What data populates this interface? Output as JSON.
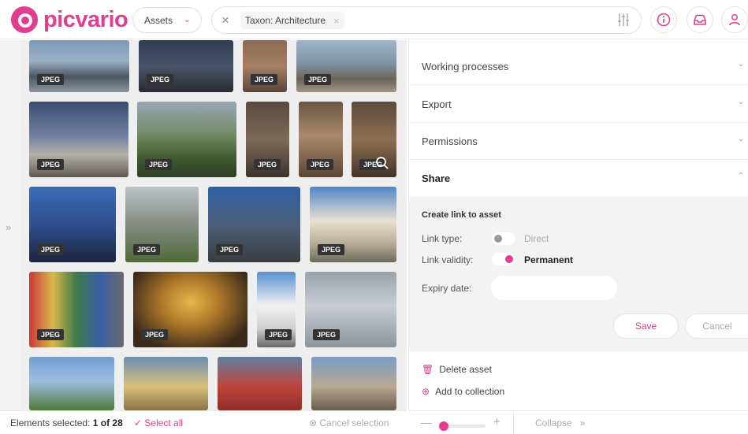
{
  "header": {
    "logo_text": "picvario",
    "assets_dropdown": "Assets",
    "filter_chip": "Taxon: Architecture"
  },
  "gallery": {
    "rows": [
      [
        {
          "format": "JPEG"
        },
        {
          "format": "JPEG"
        },
        {
          "format": "JPEG"
        },
        {
          "format": "JPEG"
        }
      ],
      [
        {
          "format": "JPEG"
        },
        {
          "format": "JPEG"
        },
        {
          "format": "JPEG"
        },
        {
          "format": "JPEG"
        },
        {
          "format": "JPEG"
        }
      ],
      [
        {
          "format": "JPEG"
        },
        {
          "format": "JPEG"
        },
        {
          "format": "JPEG"
        },
        {
          "format": "JPEG"
        }
      ],
      [
        {
          "format": "JPEG"
        },
        {
          "format": "JPEG"
        },
        {
          "format": "JPEG"
        },
        {
          "format": "JPEG"
        }
      ],
      [
        {
          "format": ""
        },
        {
          "format": ""
        },
        {
          "format": ""
        },
        {
          "format": ""
        }
      ]
    ]
  },
  "footer_left": {
    "selected_label": "Elements selected:",
    "selected_count": "1 of 28",
    "select_all": "Select all",
    "cancel_selection": "Cancel selection"
  },
  "panel": {
    "sections": [
      "Working processes",
      "Export",
      "Permissions",
      "Share"
    ],
    "share": {
      "title": "Create link to asset",
      "link_type_label": "Link type:",
      "link_type_value": "Direct",
      "link_validity_label": "Link validity:",
      "link_validity_value": "Permanent",
      "expiry_label": "Expiry date:",
      "save": "Save",
      "cancel": "Cancel"
    },
    "actions": {
      "delete": "Delete asset",
      "add_collection": "Add to collection"
    }
  },
  "footer_right": {
    "collapse": "Collapse",
    "zoom_level": 0.1
  },
  "colors": {
    "accent": "#e23d90"
  }
}
